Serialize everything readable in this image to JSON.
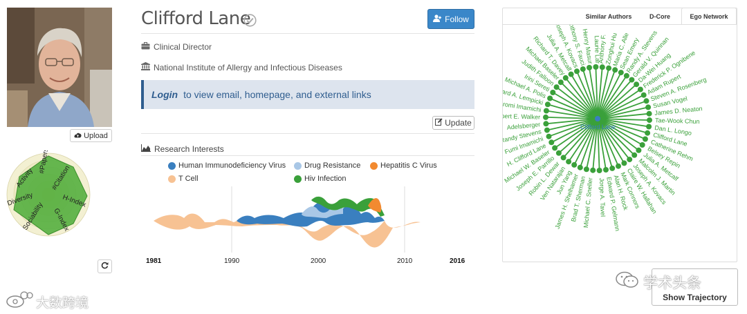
{
  "profile": {
    "name": "Clifford Lane",
    "follow_label": "Follow",
    "position": "Clinical Director",
    "affiliation": "National Institute of Allergy and Infectious Diseases",
    "login_link": "Login",
    "login_text": "to view email, homepage, and external links",
    "update_label": "Update",
    "upload_label": "Upload"
  },
  "radar": {
    "labels": [
      "#Papers",
      "#Citation",
      "H-Index",
      "G-Index",
      "Sociability",
      "Diversity",
      "Activity"
    ]
  },
  "research": {
    "title": "Research Interests",
    "legend": [
      {
        "label": "Human Immunodeficiency Virus",
        "color": "#3a7fbf"
      },
      {
        "label": "Drug Resistance",
        "color": "#a9c7e6"
      },
      {
        "label": "Hepatitis C Virus",
        "color": "#f28a30"
      },
      {
        "label": "T Cell",
        "color": "#f7c293"
      },
      {
        "label": "Hiv Infection",
        "color": "#3aa03a"
      }
    ],
    "axis": {
      "start": "1981",
      "ticks": [
        "1990",
        "2000",
        "2010"
      ],
      "end": "2016"
    }
  },
  "network": {
    "tabs": [
      "Similar Authors",
      "D-Core",
      "Ego Network"
    ],
    "active_tab": "Ego Network",
    "center": "Clifford Lane",
    "coauthors": [
      "Laurie Lar",
      "Anthony F.",
      "Zonghui Hu",
      "Maria C. Alle",
      "Sean Emery",
      "Randy A. Stevens",
      "Gerald V. Quinnan",
      "Da-Wei Huang",
      "Frederick P. Ognibene",
      "Adam Rupert",
      "Steven A. Rosenberg",
      "Susan Vogel",
      "James D. Neaton",
      "Tae-Wook Chun",
      "Dan L. Longo",
      "Clifford Lane",
      "Catherine Rehm",
      "Belsey Repin",
      "Julia A. Metcalf",
      "Malcolm J. Martin",
      "Joseph A. Kovacs",
      "Claire W. Hallahan",
      "Mark Connors",
      "Alan H. Rock",
      "Edward P. Gelmann",
      "Jorge A. Tavel",
      "Michael C. Sneller",
      "Brad T. Sherman",
      "James H. Shelhamer",
      "Jun Yang",
      "Ven Natarajan",
      "Robin L. Dewar",
      "Joseph E. Parrillo",
      "Michael W. Baseler",
      "H. Clifford Lane",
      "Fumi Imamichi",
      "Randy Stevens",
      "Adelsberger",
      "Robert E. Walker",
      "Hiromi Imamichi",
      "Richard A. Lempicki",
      "Michael A. Polis",
      "Irini Sereti",
      "Judith Falloon",
      "Michael Baseler",
      "Richard T. Davey",
      "Julia A. Metcalf",
      "Joseph A. Kovacs",
      "Anthony S. Fauci",
      "Henry Masur"
    ]
  },
  "actions": {
    "show_trajectory": "Show Trajectory"
  },
  "watermarks": {
    "right": "学术头条",
    "left": "大数跨境"
  }
}
